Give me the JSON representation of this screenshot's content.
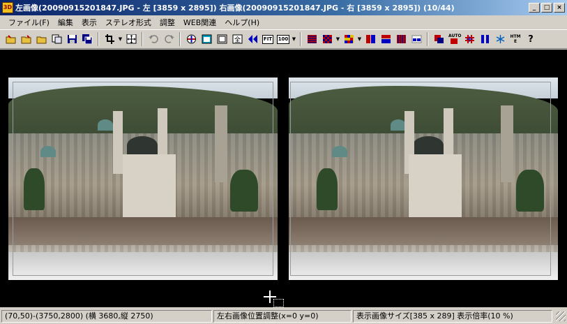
{
  "window": {
    "title": "左画像(20090915201847.JPG - 左 [3859 x 2895]) 右画像(20090915201847.JPG - 右 [3859 x 2895]) (10/44)",
    "app_icon_text": "3D",
    "minimize_glyph": "_",
    "maximize_glyph": "□",
    "close_glyph": "×"
  },
  "menu": {
    "items": [
      "ファイル(F)",
      "編集",
      "表示",
      "ステレオ形式",
      "調整",
      "WEB関連",
      "ヘルプ(H)"
    ]
  },
  "toolbar": {
    "fit_label": "FIT",
    "zoom100_label": "100",
    "anaglyph_label": "AUTO",
    "html_label": "HTM E",
    "help_label": "?"
  },
  "status": {
    "selection": "(70,50)-(3750,2800) (横 3680,縦 2750)",
    "offset": "左右画像位置調整(x=0 y=0)",
    "display": "表示画像サイズ[385 x 289]  表示倍率(10 %)"
  }
}
